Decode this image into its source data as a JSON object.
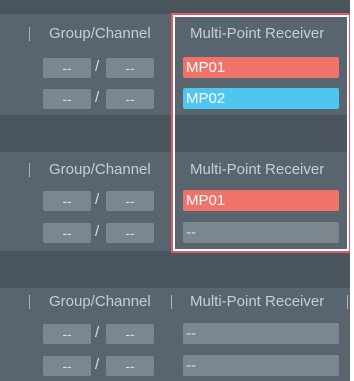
{
  "column_headers": {
    "group_channel": "Group/Channel",
    "multi_point_receiver": "Multi-Point Receiver"
  },
  "sections": [
    {
      "rows": [
        {
          "group": "--",
          "channel": "--",
          "receiver": "MP01",
          "receiver_color": "#f0736a"
        },
        {
          "group": "--",
          "channel": "--",
          "receiver": "MP02",
          "receiver_color": "#4fc6ef"
        }
      ]
    },
    {
      "rows": [
        {
          "group": "--",
          "channel": "--",
          "receiver": "MP01",
          "receiver_color": "#f0736a"
        },
        {
          "group": "--",
          "channel": "--",
          "receiver": "--",
          "receiver_color": "#7b868e"
        }
      ]
    },
    {
      "rows": [
        {
          "group": "--",
          "channel": "--",
          "receiver": "--",
          "receiver_color": "#7b868e"
        },
        {
          "group": "--",
          "channel": "--",
          "receiver": "--",
          "receiver_color": "#7b868e"
        }
      ]
    }
  ],
  "separator": "/",
  "highlight_color": "#e35a62"
}
